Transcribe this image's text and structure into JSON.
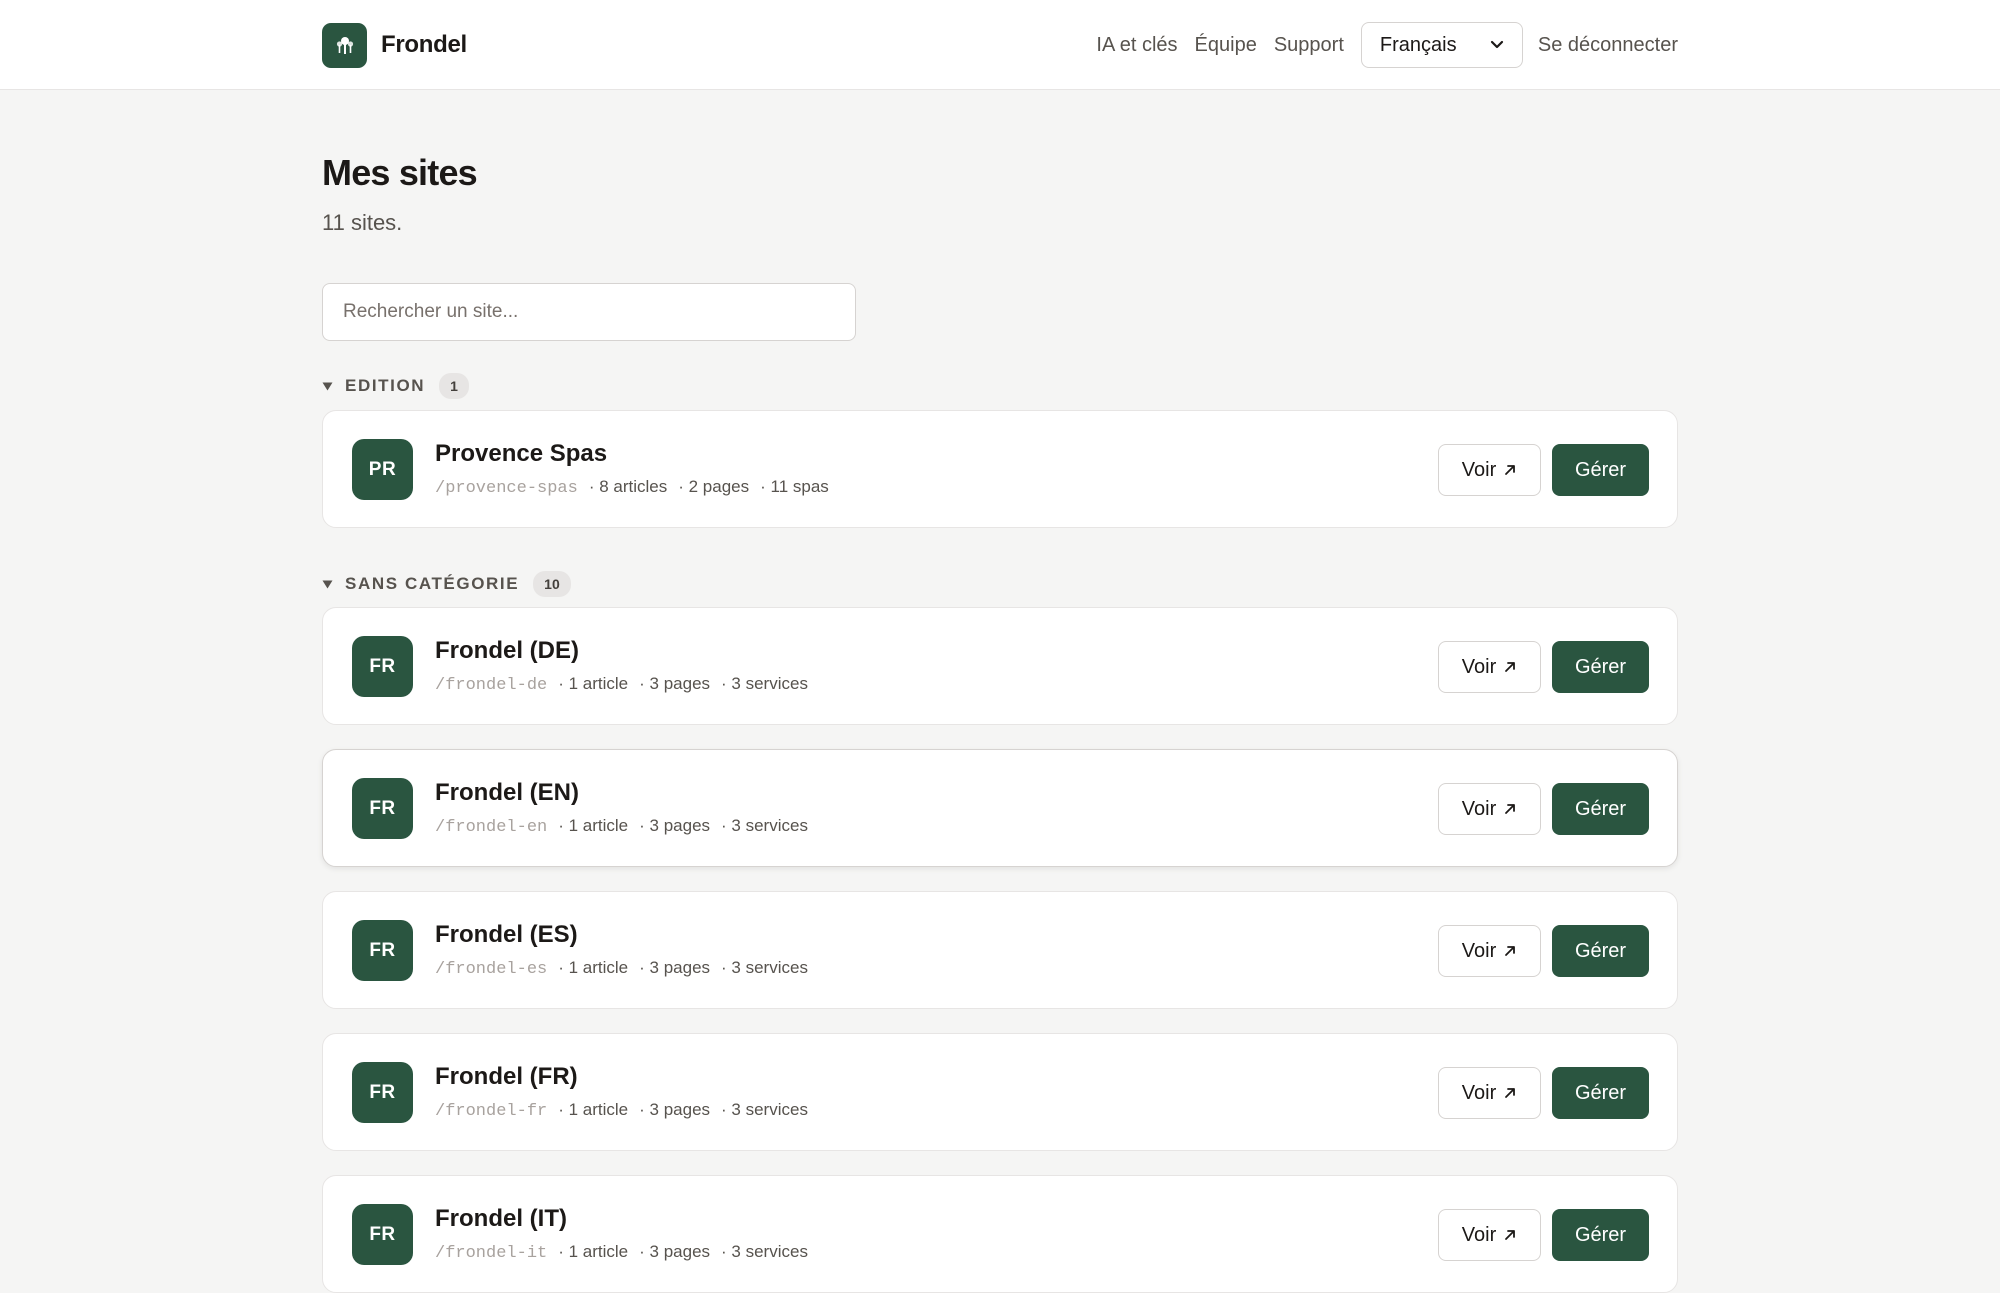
{
  "app": {
    "name": "Frondel"
  },
  "nav": {
    "links": [
      "IA et clés",
      "Équipe",
      "Support"
    ],
    "language": "Français",
    "logout": "Se déconnecter"
  },
  "page": {
    "title": "Mes sites",
    "subtitle": "11 sites.",
    "search_placeholder": "Rechercher un site..."
  },
  "groups": [
    {
      "label": "EDITION",
      "count": "1",
      "sites": [
        {
          "initials": "PR",
          "name": "Provence Spas",
          "slug": "/provence-spas",
          "meta": [
            "· 8 articles",
            "· 2 pages",
            "· 11 spas"
          ]
        }
      ]
    },
    {
      "label": "SANS CATÉGORIE",
      "count": "10",
      "sites": [
        {
          "initials": "FR",
          "name": "Frondel (DE)",
          "slug": "/frondel-de",
          "meta": [
            "· 1 article",
            "· 3 pages",
            "· 3 services"
          ]
        },
        {
          "initials": "FR",
          "name": "Frondel (EN)",
          "slug": "/frondel-en",
          "meta": [
            "· 1 article",
            "· 3 pages",
            "· 3 services"
          ]
        },
        {
          "initials": "FR",
          "name": "Frondel (ES)",
          "slug": "/frondel-es",
          "meta": [
            "· 1 article",
            "· 3 pages",
            "· 3 services"
          ]
        },
        {
          "initials": "FR",
          "name": "Frondel (FR)",
          "slug": "/frondel-fr",
          "meta": [
            "· 1 article",
            "· 3 pages",
            "· 3 services"
          ]
        },
        {
          "initials": "FR",
          "name": "Frondel (IT)",
          "slug": "/frondel-it",
          "meta": [
            "· 1 article",
            "· 3 pages",
            "· 3 services"
          ]
        }
      ]
    }
  ],
  "buttons": {
    "view": "Voir",
    "manage": "Gérer"
  },
  "colors": {
    "brand": "#2a5540",
    "background": "#f5f5f4",
    "muted": "#57534e"
  },
  "icons": {
    "logo": "tree-logo-icon",
    "view": "external-arrow-icon",
    "caret": "caret-down-icon",
    "select": "chevron-down-icon"
  }
}
